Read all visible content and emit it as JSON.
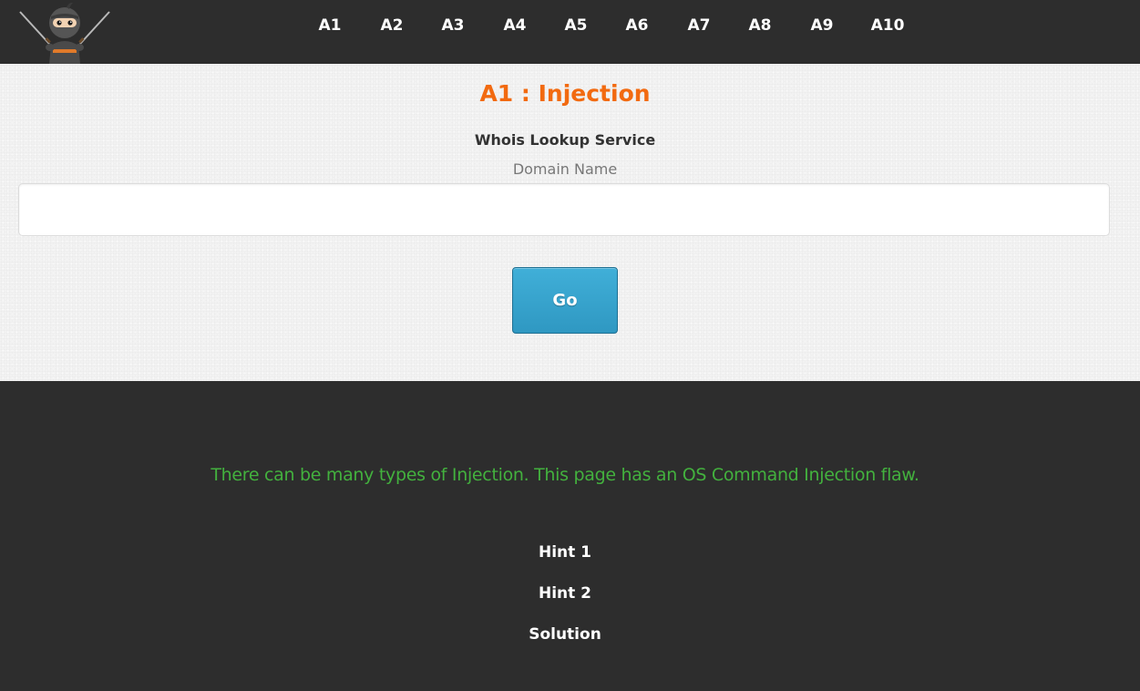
{
  "nav": {
    "items": [
      {
        "label": "A1"
      },
      {
        "label": "A2"
      },
      {
        "label": "A3"
      },
      {
        "label": "A4"
      },
      {
        "label": "A5"
      },
      {
        "label": "A6"
      },
      {
        "label": "A7"
      },
      {
        "label": "A8"
      },
      {
        "label": "A9"
      },
      {
        "label": "A10"
      }
    ]
  },
  "logo": {
    "icon": "ninja-mascot-icon"
  },
  "main": {
    "title": "A1 : Injection",
    "service_title": "Whois Lookup Service",
    "domain_label": "Domain Name",
    "domain_value": "",
    "go_label": "Go"
  },
  "footer": {
    "note": "There can be many types of Injection. This page has an OS Command Injection flaw.",
    "links": [
      {
        "label": "Hint 1"
      },
      {
        "label": "Hint 2"
      },
      {
        "label": "Solution"
      }
    ]
  },
  "colors": {
    "title_accent": "#f26a10",
    "note_green": "#43b13e",
    "button_blue": "#3aa6d0",
    "dark_bg": "#2d2d2d"
  }
}
